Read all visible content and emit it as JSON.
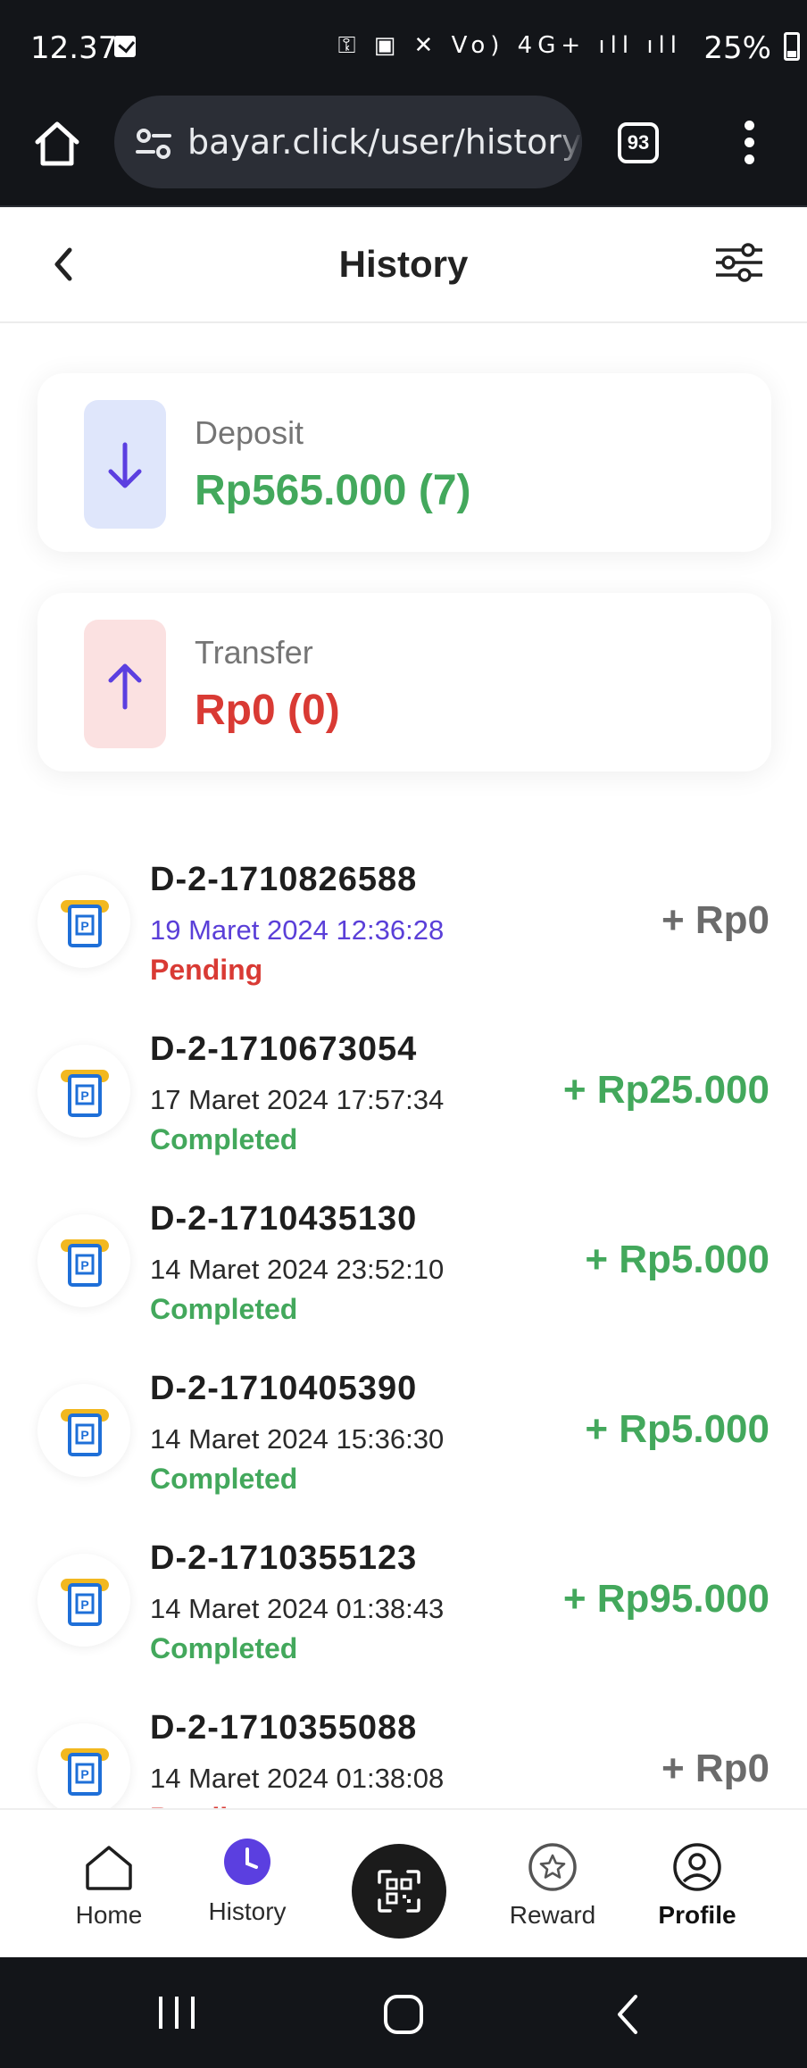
{
  "status_bar": {
    "time": "12.37",
    "network_icons": "⚿ ▣ ✕ Vo) 4G+ ıll ıll",
    "battery": "25%"
  },
  "browser": {
    "url": "bayar.click/user/history",
    "tab_count": "93"
  },
  "header": {
    "title": "History"
  },
  "summary": {
    "deposit": {
      "label": "Deposit",
      "amount": "Rp565.000 (7)",
      "color": "#43a85c",
      "bg": "#dfe6fb"
    },
    "transfer": {
      "label": "Transfer",
      "amount": "Rp0 (0)",
      "color": "#d93a34",
      "bg": "#fbe1e1"
    }
  },
  "transactions": [
    {
      "id": "D-2-1710826588",
      "date": "19 Maret 2024 12:36:28",
      "status": "Pending",
      "amount": "+ Rp0"
    },
    {
      "id": "D-2-1710673054",
      "date": "17 Maret 2024 17:57:34",
      "status": "Completed",
      "amount": "+ Rp25.000"
    },
    {
      "id": "D-2-1710435130",
      "date": "14 Maret 2024 23:52:10",
      "status": "Completed",
      "amount": "+ Rp5.000"
    },
    {
      "id": "D-2-1710405390",
      "date": "14 Maret 2024 15:36:30",
      "status": "Completed",
      "amount": "+ Rp5.000"
    },
    {
      "id": "D-2-1710355123",
      "date": "14 Maret 2024 01:38:43",
      "status": "Completed",
      "amount": "+ Rp95.000"
    },
    {
      "id": "D-2-1710355088",
      "date": "14 Maret 2024 01:38:08",
      "status": "Pending",
      "amount": "+ Rp0"
    }
  ],
  "colors": {
    "pending": "#d93a34",
    "completed": "#43a85c",
    "pending_date": "#5a3fd8",
    "zero_amount": "#6b6b6b",
    "accent": "#5b3fe0"
  },
  "bottom_nav": {
    "home": "Home",
    "history": "History",
    "scan": "scan-qr-icon",
    "reward": "Reward",
    "profile": "Profile"
  }
}
